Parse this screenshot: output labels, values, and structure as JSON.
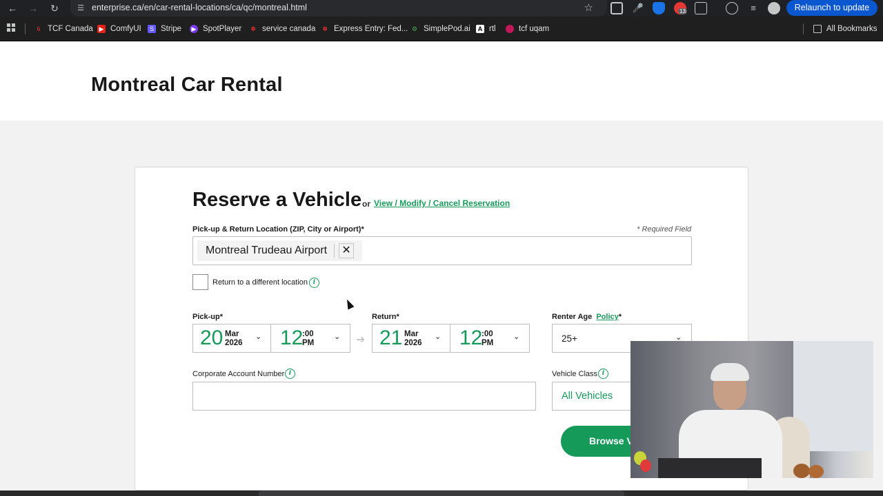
{
  "browser": {
    "url": "enterprise.ca/en/car-rental-locations/ca/qc/montreal.html",
    "relaunch_label": "Relaunch to update",
    "extension_badge": "13",
    "bookmarks": [
      {
        "label": "TCF Canada",
        "color": "#e53935",
        "icon": "flame-icon"
      },
      {
        "label": "ComfyUI",
        "color": "#e62117",
        "icon": "youtube-icon"
      },
      {
        "label": "Stripe",
        "color": "#635bff",
        "icon": "stripe-icon"
      },
      {
        "label": "SpotPlayer",
        "color": "#7c3aed",
        "icon": "spotplayer-icon"
      },
      {
        "label": "service canada",
        "color": "#d32f2f",
        "icon": "maple-leaf-icon"
      },
      {
        "label": "Express Entry: Fed...",
        "color": "#d32f2f",
        "icon": "maple-leaf-icon"
      },
      {
        "label": "SimplePod.ai",
        "color": "#4caf50",
        "icon": "simplepod-icon"
      },
      {
        "label": "rtl",
        "color": "#222222",
        "icon": "ai-icon"
      },
      {
        "label": "tcf uqam",
        "color": "#c2185b",
        "icon": "uqam-icon"
      }
    ],
    "all_bookmarks_label": "All Bookmarks"
  },
  "page": {
    "title": "Montreal Car Rental"
  },
  "reserve": {
    "title": "Reserve a Vehicle",
    "or": "or",
    "modify_link": "View / Modify / Cancel Reservation",
    "location_label": "Pick-up & Return Location (ZIP, City or Airport)*",
    "required_note": "* Required Field",
    "location_value": "Montreal Trudeau Airport",
    "return_different": "Return to a different location",
    "pickup_label": "Pick-up*",
    "return_label": "Return*",
    "pickup": {
      "day": "20",
      "month": "Mar",
      "year": "2026",
      "hour": "12",
      "minutes": ":00",
      "ampm": "PM"
    },
    "return": {
      "day": "21",
      "month": "Mar",
      "year": "2026",
      "hour": "12",
      "minutes": ":00",
      "ampm": "PM"
    },
    "renter_age_label": "Renter Age",
    "policy_link": "Policy",
    "renter_age_asterisk": "*",
    "renter_age_value": "25+",
    "corporate_label": "Corporate Account Number",
    "corporate_value": "",
    "vehicle_class_label": "Vehicle Class",
    "vehicle_class_value": "All Vehicles",
    "browse_button": "Browse Vehicles"
  },
  "colors": {
    "brand_green": "#169a5a",
    "chrome_dark": "#202124",
    "relaunch_blue": "#0b57d0"
  }
}
